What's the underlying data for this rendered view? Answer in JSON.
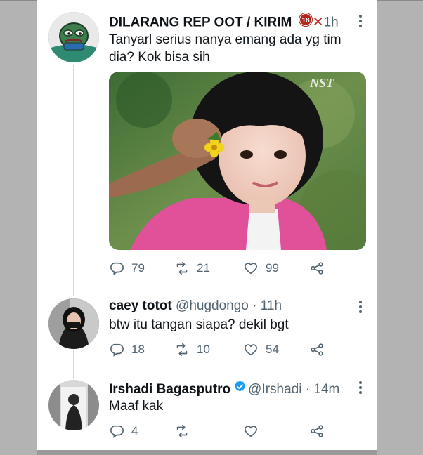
{
  "tweets": [
    {
      "name": "DILARANG REP OOT / KIRIM",
      "handle": "",
      "time": "1h",
      "text_line1": "Tanyarl serius nanya emang ada yg tim",
      "text_line2": "dia? Kok bisa sih",
      "media_watermark": "NST",
      "replies": "79",
      "retweets": "21",
      "likes": "99"
    },
    {
      "name": "caey totot",
      "handle": "@hugdongo",
      "sep": "·",
      "time": "11h",
      "text": "btw itu tangan siapa? dekil bgt",
      "replies": "18",
      "retweets": "10",
      "likes": "54"
    },
    {
      "name": "Irshadi Bagasputro",
      "handle": "@Irshadi",
      "sep": "·",
      "time": "14m",
      "text": "Maaf kak",
      "replies": "4",
      "retweets": "",
      "likes": ""
    }
  ],
  "icons": {
    "reply": "reply-icon",
    "retweet": "retweet-icon",
    "like": "heart-icon",
    "share": "share-icon",
    "verified": "verified-badge-icon",
    "more": "more-icon"
  },
  "colors": {
    "text": "#0f1419",
    "muted": "#536471",
    "verified": "#1d9bf0",
    "thread_line": "#cfd9de",
    "badge_18": "#b3261e"
  }
}
